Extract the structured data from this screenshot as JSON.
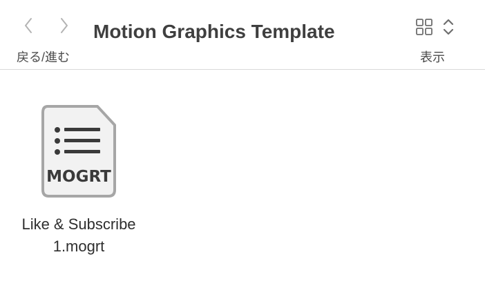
{
  "toolbar": {
    "title": "Motion Graphics Template",
    "nav_label": "戻る/進む",
    "view_label": "表示",
    "icons": {
      "back": "chevron-left-icon",
      "forward": "chevron-right-icon",
      "view_grid": "grid-view-icon",
      "view_toggle": "chevron-up-down-icon"
    }
  },
  "files": [
    {
      "name_line1": "Like & Subscribe",
      "name_line2": "1.mogrt",
      "icon_label": "MOGRT",
      "icon": "mogrt-file-icon"
    }
  ],
  "colors": {
    "icon_border": "#a6a6a6",
    "icon_fill": "#f2f2f2",
    "icon_glyph": "#3a3a3a"
  }
}
